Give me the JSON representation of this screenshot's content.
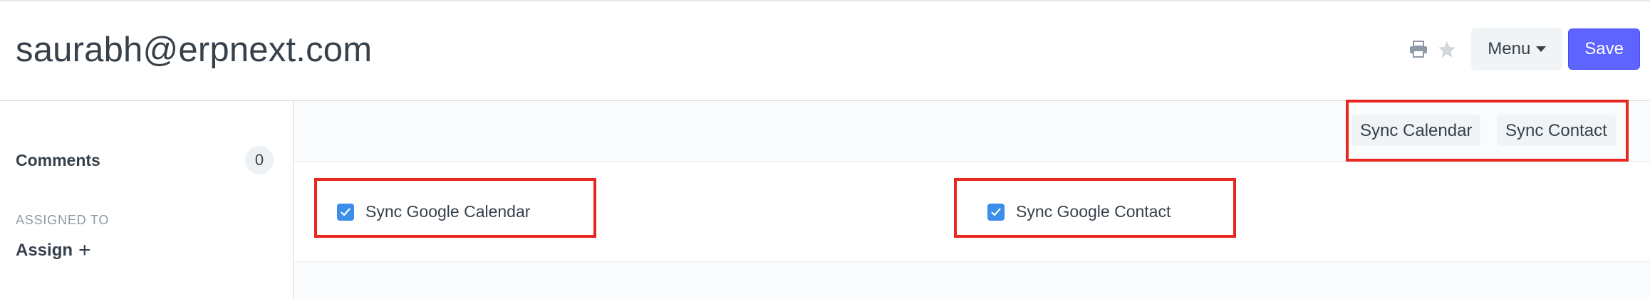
{
  "page": {
    "title": "saurabh@erpnext.com"
  },
  "header": {
    "print_icon": "printer-icon",
    "star_icon": "star-icon",
    "menu_label": "Menu",
    "save_label": "Save"
  },
  "sidebar": {
    "comments_label": "Comments",
    "comments_count": "0",
    "assigned_header": "ASSIGNED TO",
    "assign_label": "Assign",
    "assign_icon": "plus-icon"
  },
  "toolbar": {
    "sync_calendar_label": "Sync Calendar",
    "sync_contact_label": "Sync Contact"
  },
  "form": {
    "sync_google_calendar": {
      "label": "Sync Google Calendar",
      "checked": true
    },
    "sync_google_contact": {
      "label": "Sync Google Contact",
      "checked": true
    }
  },
  "colors": {
    "primary": "#5e64ff",
    "checkbox": "#3b8eea",
    "highlight": "#e8251e",
    "text": "#36414c"
  }
}
